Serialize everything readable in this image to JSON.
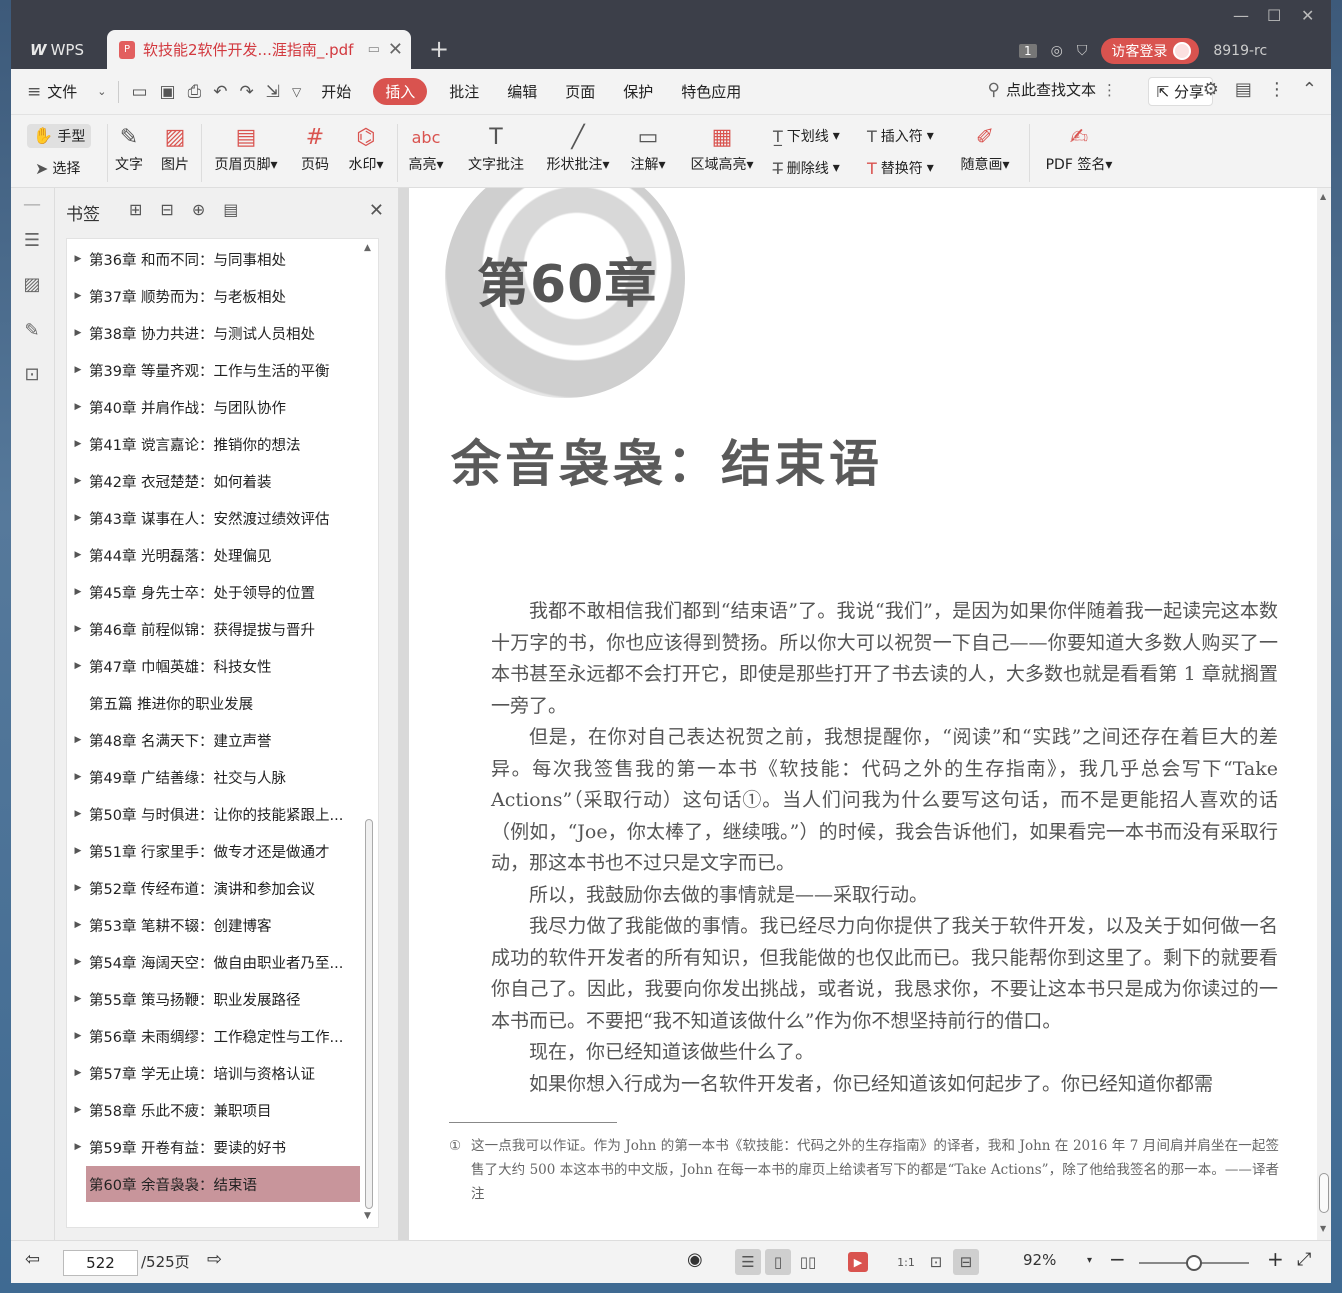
{
  "titlebar": {
    "app_name": "WPS",
    "doc_tab_title": "软技能2软件开发...涯指南_.pdf",
    "badge": "1",
    "login_label": "访客登录",
    "user_id": "8919-rc"
  },
  "menubar": {
    "file": "文件",
    "items": [
      "开始",
      "插入",
      "批注",
      "编辑",
      "页面",
      "保护",
      "特色应用"
    ],
    "active": "插入",
    "search": "点此查找文本",
    "share": "分享"
  },
  "ribbon": {
    "hand": "手型",
    "select": "选择",
    "text": "文字",
    "image": "图片",
    "header_footer": "页眉页脚",
    "page_num": "页码",
    "watermark": "水印",
    "highlight": "高亮",
    "text_comment": "文字批注",
    "shape_comment": "形状批注",
    "note": "注解",
    "area_highlight": "区域高亮",
    "underline": "下划线",
    "strikethrough": "删除线",
    "insert_mark": "插入符",
    "replace_mark": "替换符",
    "freehand": "随意画",
    "pdf_sign": "PDF 签名"
  },
  "bookmarks": {
    "title": "书签",
    "items": [
      "第36章 和而不同：与同事相处",
      "第37章 顺势而为：与老板相处",
      "第38章 协力共进：与测试人员相处",
      "第39章 等量齐观：工作与生活的平衡",
      "第40章 并肩作战：与团队协作",
      "第41章 谠言嘉论：推销你的想法",
      "第42章 衣冠楚楚：如何着装",
      "第43章 谋事在人：安然渡过绩效评估",
      "第44章 光明磊落：处理偏见",
      "第45章 身先士卒：处于领导的位置",
      "第46章 前程似锦：获得提拔与晋升",
      "第47章 巾帼英雄：科技女性",
      "第五篇 推进你的职业发展",
      "第48章 名满天下：建立声誉",
      "第49章 广结善缘：社交与人脉",
      "第50章 与时俱进：让你的技能紧跟上...",
      "第51章 行家里手：做专才还是做通才",
      "第52章 传经布道：演讲和参加会议",
      "第53章 笔耕不辍：创建博客",
      "第54章 海阔天空：做自由职业者乃至...",
      "第55章 策马扬鞭：职业发展路径",
      "第56章 未雨绸缪：工作稳定性与工作...",
      "第57章 学无止境：培训与资格认证",
      "第58章 乐此不疲：兼职项目",
      "第59章 开卷有益：要读的好书",
      "第60章 余音袅袅：结束语"
    ],
    "selected_index": 25,
    "no_arrow_index": 12
  },
  "page": {
    "chapter": "第60章",
    "title": "余音袅袅：结束语",
    "paragraphs": [
      "我都不敢相信我们都到“结束语”了。我说“我们”，是因为如果你伴随着我一起读完这本数十万字的书，你也应该得到赞扬。所以你大可以祝贺一下自己——你要知道大多数人购买了一本书甚至永远都不会打开它，即使是那些打开了书去读的人，大多数也就是看看第 1 章就搁置一旁了。",
      "但是，在你对自己表达祝贺之前，我想提醒你，“阅读”和“实践”之间还存在着巨大的差异。每次我签售我的第一本书《软技能：代码之外的生存指南》，我几乎总会写下“Take Actions”（采取行动）这句话①。当人们问我为什么要写这句话，而不是更能招人喜欢的话（例如，“Joe，你太棒了，继续哦。”）的时候，我会告诉他们，如果看完一本书而没有采取行动，那这本书也不过只是文字而已。",
      "所以，我鼓励你去做的事情就是——采取行动。",
      "我尽力做了我能做的事情。我已经尽力向你提供了我关于软件开发，以及关于如何做一名成功的软件开发者的所有知识，但我能做的也仅此而已。我只能帮你到这里了。剩下的就要看你自己了。因此，我要向你发出挑战，或者说，我恳求你，不要让这本书只是成为你读过的一本书而已。不要把“我不知道该做什么”作为你不想坚持前行的借口。",
      "现在，你已经知道该做些什么了。",
      "如果你想入行成为一名软件开发者，你已经知道该如何起步了。你已经知道你都需"
    ],
    "footnote_mark": "①",
    "footnote": "这一点我可以作证。作为 John 的第一本书《软技能：代码之外的生存指南》的译者，我和 John 在 2016 年 7 月间肩并肩坐在一起签售了大约 500 本这本书的中文版，John 在每一本书的扉页上给读者写下的都是“Take Actions”，除了他给我签名的那一本。——译者注"
  },
  "status": {
    "current_page": "522",
    "total_pages": "/525页",
    "zoom": "92%",
    "zoom_fraction": 0.5
  }
}
